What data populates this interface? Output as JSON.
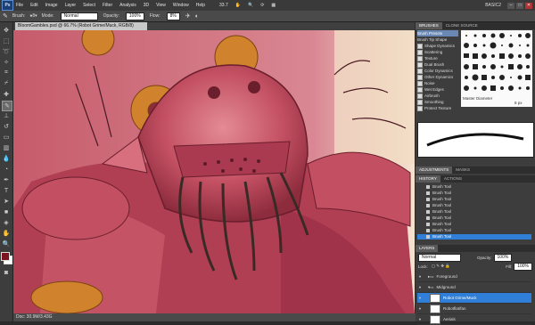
{
  "menubar": {
    "logo": "Ps",
    "items": [
      "File",
      "Edit",
      "Image",
      "Layer",
      "Select",
      "Filter",
      "Analysis",
      "3D",
      "View",
      "Window",
      "Help"
    ],
    "zoom": "33.7",
    "workspace": "BASIC2"
  },
  "options": {
    "brush_label": "Brush:",
    "brush_size": "8",
    "mode_label": "Mode:",
    "mode_value": "Normal",
    "opacity_label": "Opacity:",
    "opacity_value": "100%",
    "flow_label": "Flow:",
    "flow_value": "8%"
  },
  "document": {
    "tab_title": "BloomGambles.psd @ 66.7% (Robot Grime/Muck, RGB/8)",
    "status": "Doc: 30.9M/3.43G"
  },
  "brushes_panel": {
    "tabs": [
      "BRUSHES",
      "CLONE SOURCE"
    ],
    "options": [
      "Brush Presets",
      "Brush Tip Shape",
      "Shape Dynamics",
      "Scattering",
      "Texture",
      "Dual Brush",
      "Color Dynamics",
      "Other Dynamics",
      "Noise",
      "Wet Edges",
      "Airbrush",
      "Smoothing",
      "Protect Texture"
    ],
    "master_diameter_label": "Master Diameter",
    "master_diameter_value": "8 px"
  },
  "adjustments_panel": {
    "tabs": [
      "ADJUSTMENTS",
      "MASKS"
    ]
  },
  "history_panel": {
    "tabs": [
      "HISTORY",
      "ACTIONS"
    ],
    "items": [
      "Brush Tool",
      "Brush Tool",
      "Brush Tool",
      "Brush Tool",
      "Brush Tool",
      "Brush Tool",
      "Brush Tool",
      "Brush Tool",
      "Brush Tool"
    ]
  },
  "layers_panel": {
    "tabs": [
      "LAYERS"
    ],
    "blend_mode": "Normal",
    "opacity_label": "Opacity:",
    "opacity_value": "100%",
    "lock_label": "Lock:",
    "fill_label": "Fill:",
    "fill_value": "100%",
    "layers": [
      "Foreground",
      "Midground",
      "Robot Grime/Muck",
      "Robotflat/fan",
      "Aerials",
      ""
    ]
  },
  "colors": {
    "accent": "#2f7fd8",
    "foreground": "#7a1421",
    "background": "#ffffff"
  }
}
